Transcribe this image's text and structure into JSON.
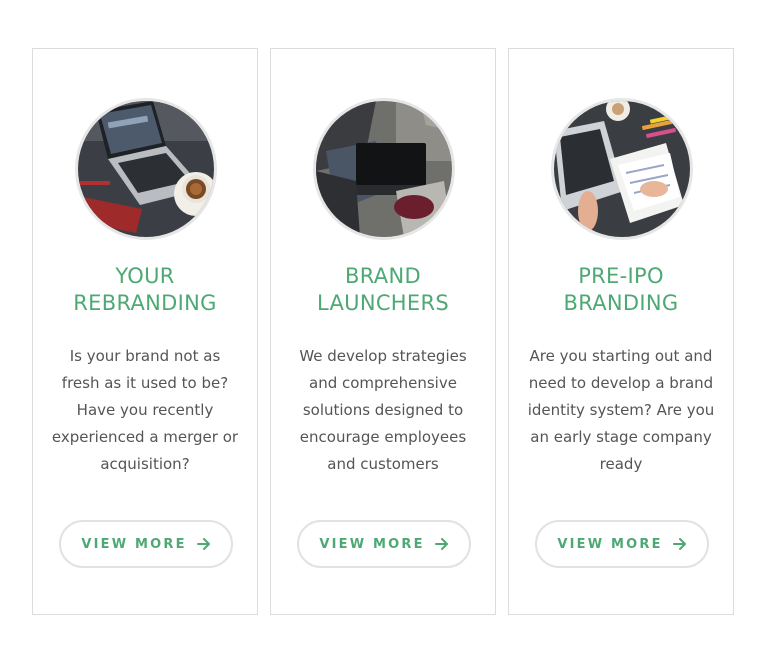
{
  "colors": {
    "accent": "#4ea874",
    "text": "#555555",
    "border": "#dcdcdc",
    "button_border": "#e2e2e2"
  },
  "cards": [
    {
      "title_lines": [
        "YOUR",
        "REBRANDING"
      ],
      "description_lines": [
        "Is your brand not as",
        "fresh as it used to be?",
        "Have you recently",
        "experienced a merger or",
        "acquisition?"
      ],
      "button_label": "VIEW MORE",
      "button_icon": "arrow-right-icon",
      "image": "laptop-and-coffee-photo"
    },
    {
      "title_lines": [
        "BRAND",
        "LAUNCHERS"
      ],
      "description_lines": [
        "We develop strategies",
        "and comprehensive",
        "solutions designed to",
        "encourage employees",
        "and customers"
      ],
      "button_label": "VIEW MORE",
      "button_icon": "arrow-right-icon",
      "image": "person-with-laptop-photo"
    },
    {
      "title_lines": [
        "PRE-IPO",
        "BRANDING"
      ],
      "description_lines": [
        "Are you starting out and",
        "need to develop a brand",
        "identity system? Are you",
        "an early stage company",
        "ready"
      ],
      "button_label": "VIEW MORE",
      "button_icon": "arrow-right-icon",
      "image": "desk-papers-and-laptop-photo"
    }
  ]
}
